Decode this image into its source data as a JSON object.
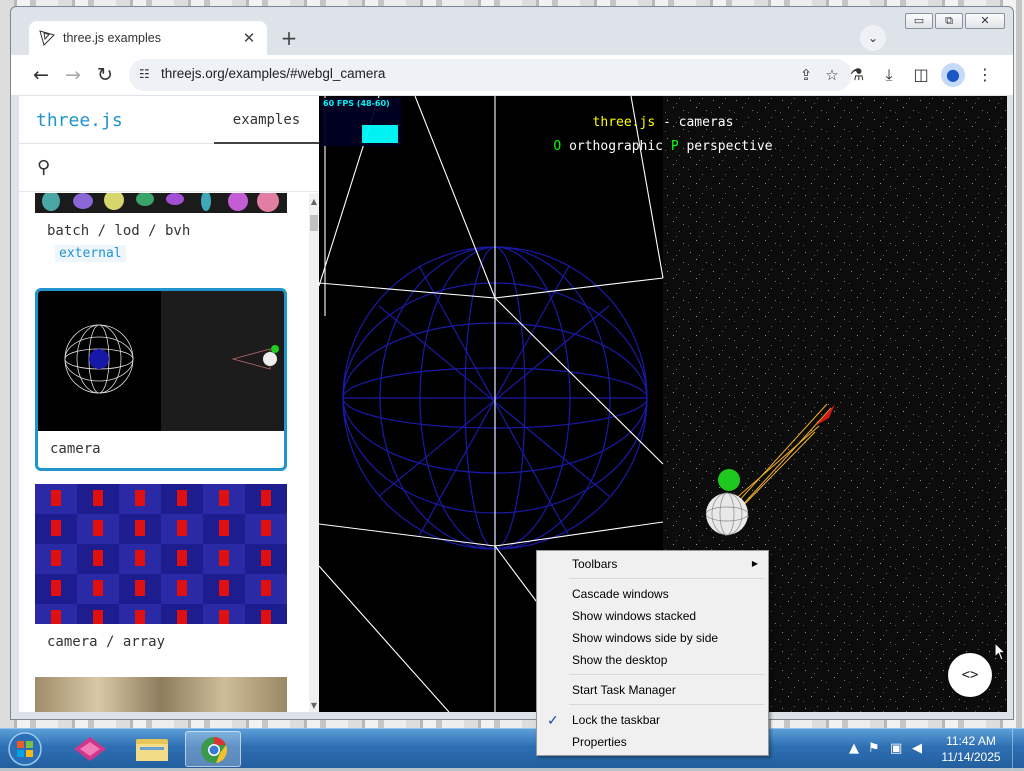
{
  "browser": {
    "tab_title": "three.js examples",
    "tab_close": "✕",
    "new_tab": "+",
    "tab_search": "⌄",
    "url": "threejs.org/examples/#webgl_camera",
    "window_controls": {
      "minimize": "▭",
      "restore": "⧉",
      "close": "✕"
    }
  },
  "sidebar": {
    "brand": "three.js",
    "tab": "examples",
    "cards": [
      {
        "label": "batch / lod / bvh",
        "tag": "external"
      },
      {
        "label": "camera",
        "selected": true
      },
      {
        "label": "camera / array"
      }
    ]
  },
  "scene": {
    "fps": "60 FPS (48-60)",
    "title_brand": "three.js",
    "title_rest": " - cameras",
    "key_o": "O",
    "label_o": " orthographic ",
    "key_p": "P",
    "label_p": " perspective",
    "code_button": "<>"
  },
  "context_menu": {
    "items": [
      {
        "label": "Toolbars",
        "submenu": true
      },
      {
        "label": "Cascade windows"
      },
      {
        "label": "Show windows stacked"
      },
      {
        "label": "Show windows side by side"
      },
      {
        "label": "Show the desktop"
      },
      {
        "label": "Start Task Manager"
      },
      {
        "label": "Lock the taskbar",
        "checked": true
      },
      {
        "label": "Properties"
      }
    ]
  },
  "taskbar": {
    "time": "11:42 AM",
    "date": "11/14/2025"
  },
  "colors": {
    "accent": "#2194ce",
    "sphere_wire": "#1a1aa8",
    "camera_helper": "#ffffff"
  }
}
